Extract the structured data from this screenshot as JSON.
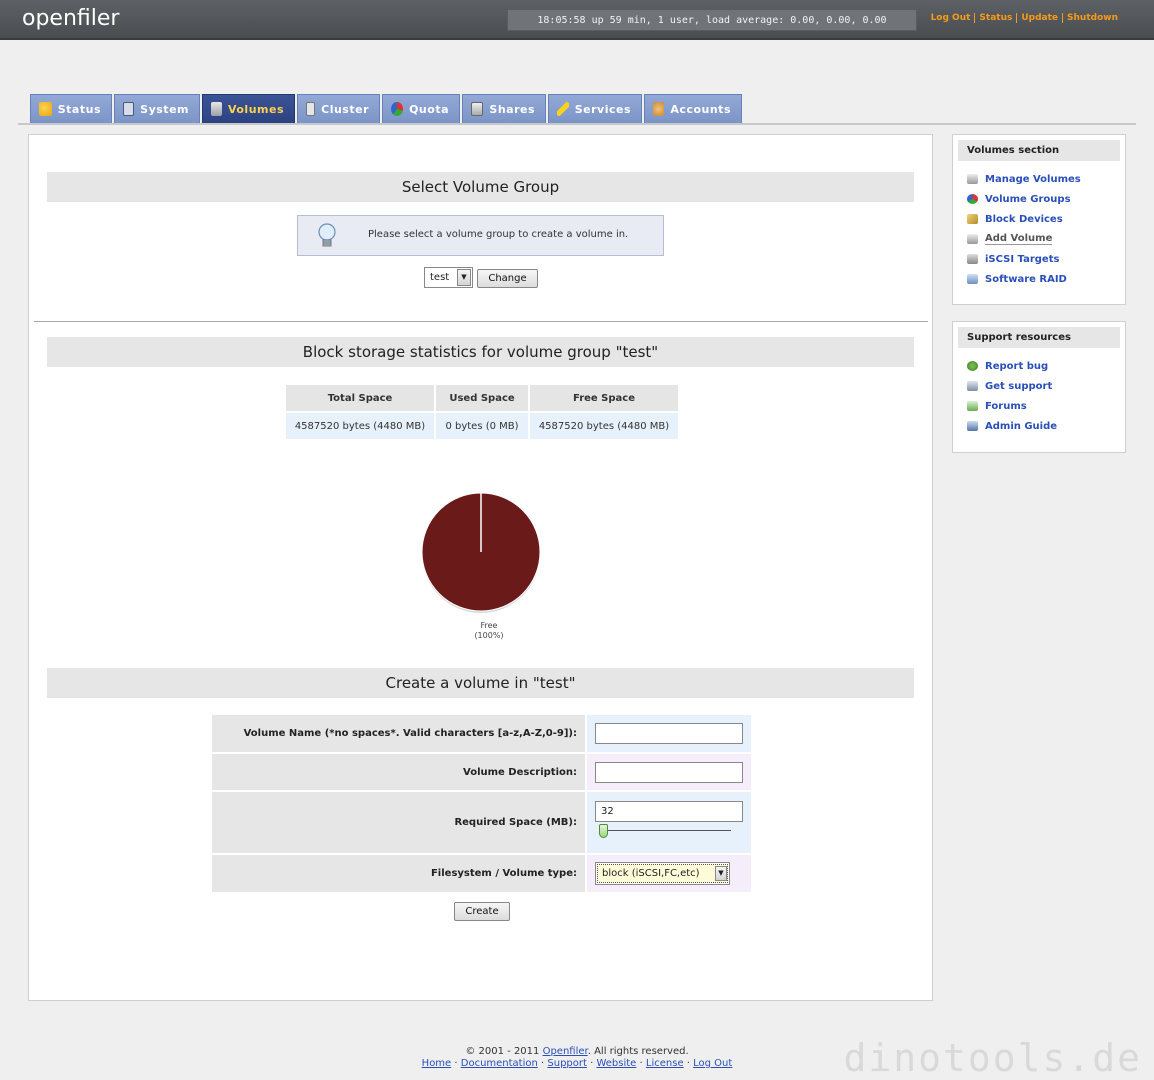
{
  "header": {
    "logo": "openfiler",
    "uptime": "18:05:58 up 59 min, 1 user, load average: 0.00, 0.00, 0.00",
    "links": [
      "Log Out",
      "Status",
      "Update",
      "Shutdown"
    ]
  },
  "tabs": [
    {
      "label": "Status",
      "icon": "weather-icon",
      "active": false
    },
    {
      "label": "System",
      "icon": "monitor-icon",
      "active": false
    },
    {
      "label": "Volumes",
      "icon": "drive-icon",
      "active": true
    },
    {
      "label": "Cluster",
      "icon": "cluster-icon",
      "active": false
    },
    {
      "label": "Quota",
      "icon": "pie-icon",
      "active": false
    },
    {
      "label": "Shares",
      "icon": "server-icon",
      "active": false
    },
    {
      "label": "Services",
      "icon": "lightning-icon",
      "active": false
    },
    {
      "label": "Accounts",
      "icon": "users-icon",
      "active": false
    }
  ],
  "select_vg": {
    "title": "Select Volume Group",
    "hint": "Please select a volume group to create a volume in.",
    "selected": "test",
    "change_label": "Change"
  },
  "stats": {
    "title": "Block storage statistics for volume group \"test\"",
    "headers": [
      "Total Space",
      "Used Space",
      "Free Space"
    ],
    "values": [
      "4587520 bytes (4480 MB)",
      "0 bytes (0 MB)",
      "4587520 bytes (4480 MB)"
    ],
    "pie_label": "Free",
    "pie_pct": "(100%)",
    "free_fraction": 1.0,
    "pie_color": "#6b1a1a"
  },
  "create": {
    "title": "Create a volume in \"test\"",
    "name_label": "Volume Name (*no spaces*. Valid characters [a-z,A-Z,0-9]):",
    "desc_label": "Volume Description:",
    "space_label": "Required Space (MB):",
    "space_value": "32",
    "fs_label": "Filesystem / Volume type:",
    "fs_value": "block (iSCSI,FC,etc)",
    "create_label": "Create"
  },
  "sidebar": {
    "volumes_title": "Volumes section",
    "volumes_items": [
      {
        "label": "Manage Volumes",
        "icon": "drive-icon",
        "current": false
      },
      {
        "label": "Volume Groups",
        "icon": "group-icon",
        "current": false
      },
      {
        "label": "Block Devices",
        "icon": "block-icon",
        "current": false
      },
      {
        "label": "Add Volume",
        "icon": "add-icon",
        "current": true
      },
      {
        "label": "iSCSI Targets",
        "icon": "target-icon",
        "current": false
      },
      {
        "label": "Software RAID",
        "icon": "raid-icon",
        "current": false
      }
    ],
    "support_title": "Support resources",
    "support_items": [
      {
        "label": "Report bug",
        "icon": "bug-icon"
      },
      {
        "label": "Get support",
        "icon": "support-icon"
      },
      {
        "label": "Forums",
        "icon": "forum-icon"
      },
      {
        "label": "Admin Guide",
        "icon": "book-icon"
      }
    ]
  },
  "footer": {
    "copyright_prefix": "© 2001 - 2011 ",
    "openfiler_link": "Openfiler",
    "copyright_suffix": ". All rights reserved.",
    "links": [
      "Home",
      "Documentation",
      "Support",
      "Website",
      "License",
      "Log Out"
    ]
  },
  "watermark": "dinotools.de"
}
